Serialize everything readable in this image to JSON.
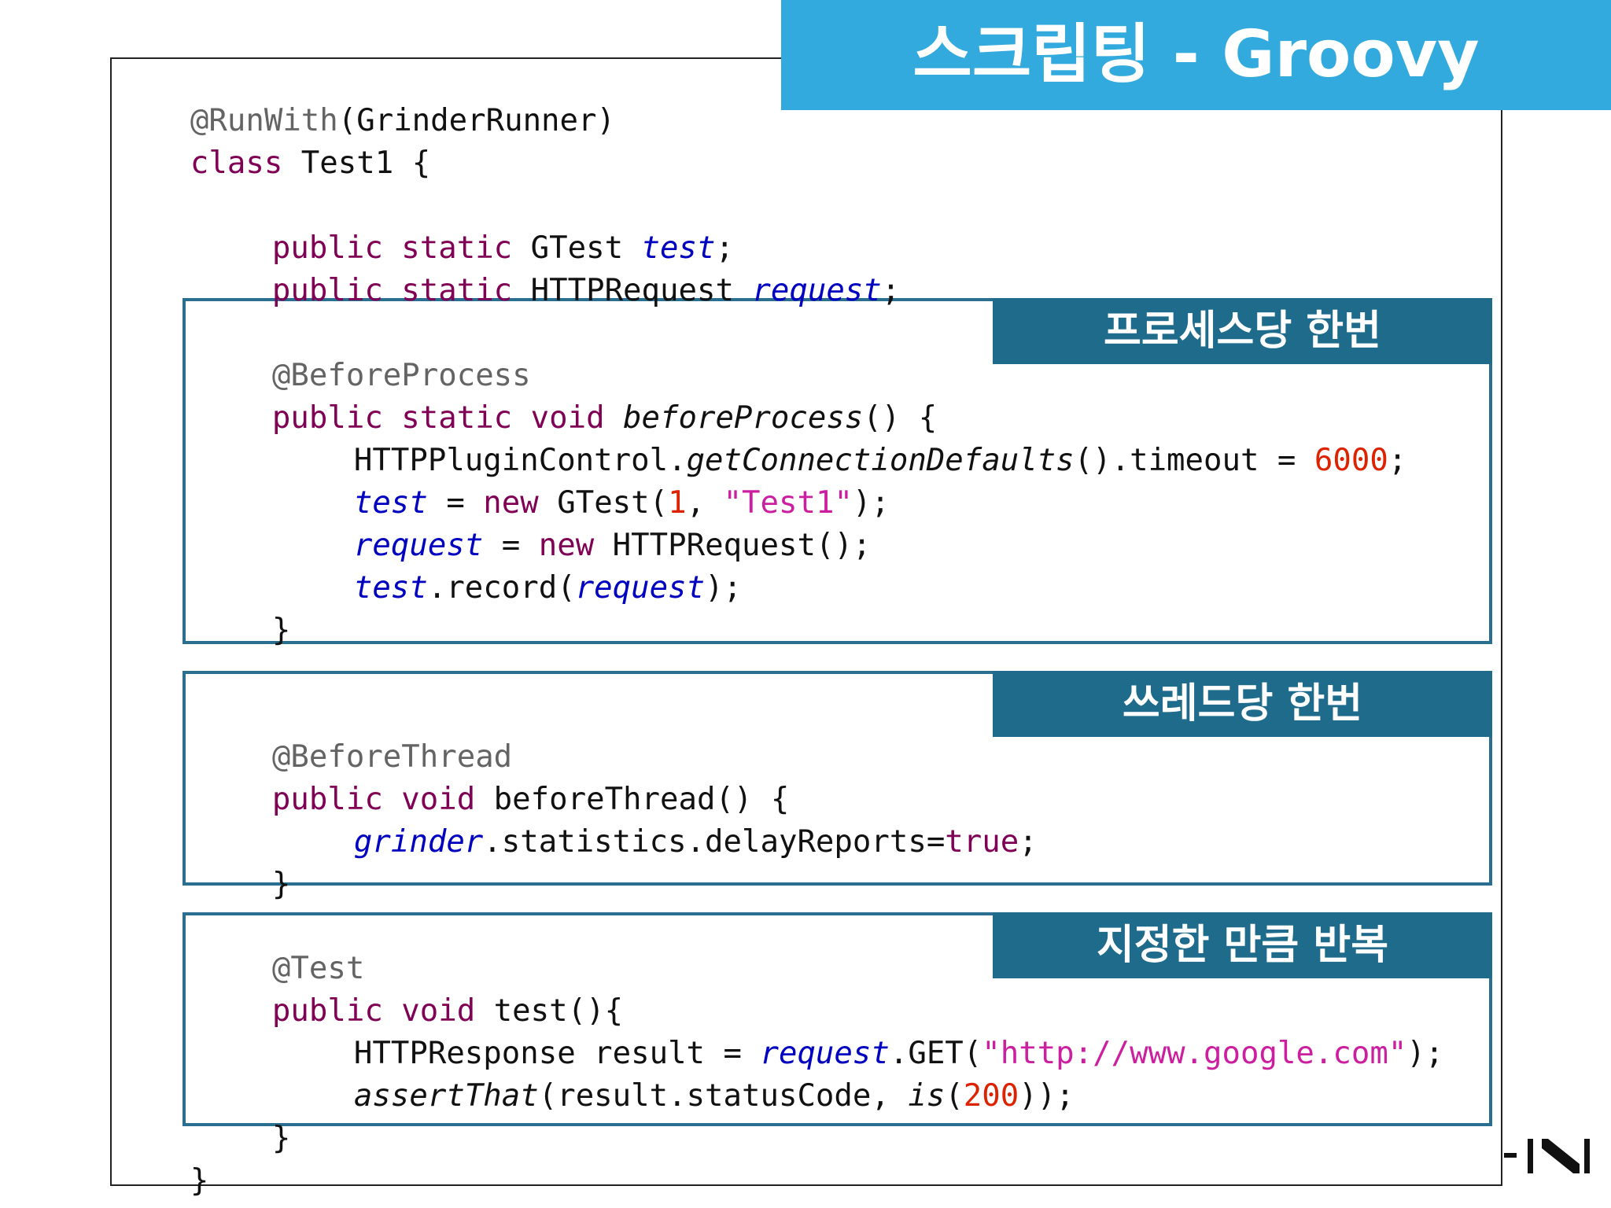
{
  "slide": {
    "title": "스크립팅 - Groovy"
  },
  "labels": {
    "per_process": "프로세스당 한번",
    "per_thread": "쓰레드당 한번",
    "repeat": "지정한 만큼 반복"
  },
  "code": {
    "l01_ann": "@RunWith",
    "l01_rest": "(GrinderRunner)",
    "l02_kw": "class",
    "l02_rest": " Test1 {",
    "l03_kw": "public static",
    "l03_type": " GTest ",
    "l03_fld": "test",
    "l03_end": ";",
    "l04_kw": "public static",
    "l04_type": " HTTPRequest ",
    "l04_fld": "request",
    "l04_end": ";",
    "l05_ann": "@BeforeProcess",
    "l06_kw": "public static void",
    "l06_meth": " beforeProcess",
    "l06_end": "() {",
    "l07_a": "HTTPPluginControl.",
    "l07_meth": "getConnectionDefaults",
    "l07_b": "().timeout = ",
    "l07_num": "6000",
    "l07_end": ";",
    "l08_fld": "test",
    "l08_a": " = ",
    "l08_kw": "new",
    "l08_b": " GTest(",
    "l08_num": "1",
    "l08_c": ", ",
    "l08_str": "\"Test1\"",
    "l08_end": ");",
    "l09_fld": "request",
    "l09_a": " = ",
    "l09_kw": "new",
    "l09_b": " HTTPRequest();",
    "l10_fld": "test",
    "l10_a": ".record(",
    "l10_fld2": "request",
    "l10_end": ");",
    "l11": "}",
    "l12_ann": "@BeforeThread",
    "l13_kw": "public void",
    "l13_rest": " beforeThread() {",
    "l14_fld": "grinder",
    "l14_a": ".statistics.delayReports=",
    "l14_kw": "true",
    "l14_end": ";",
    "l15": "}",
    "l16_ann": "@Test",
    "l17_kw": "public void",
    "l17_rest": " test(){",
    "l18_a": "HTTPResponse result = ",
    "l18_fld": "request",
    "l18_b": ".GET(",
    "l18_str": "\"http://www.google.com\"",
    "l18_end": ");",
    "l19_meth": "assertThat",
    "l19_a": "(result.statusCode, ",
    "l19_meth2": "is",
    "l19_b": "(",
    "l19_num": "200",
    "l19_end": "));",
    "l20": "}",
    "l21": "}"
  },
  "colors": {
    "banner": "#33aadd",
    "label_bg": "#1f6b8c",
    "box_border": "#2a6f8f",
    "keyword": "#7f0055",
    "annotation": "#646464",
    "field": "#0000c0",
    "number": "#dd2200",
    "string": "#cc1fa0"
  },
  "icons": {
    "corner_logo": "nhn-logo-icon"
  }
}
